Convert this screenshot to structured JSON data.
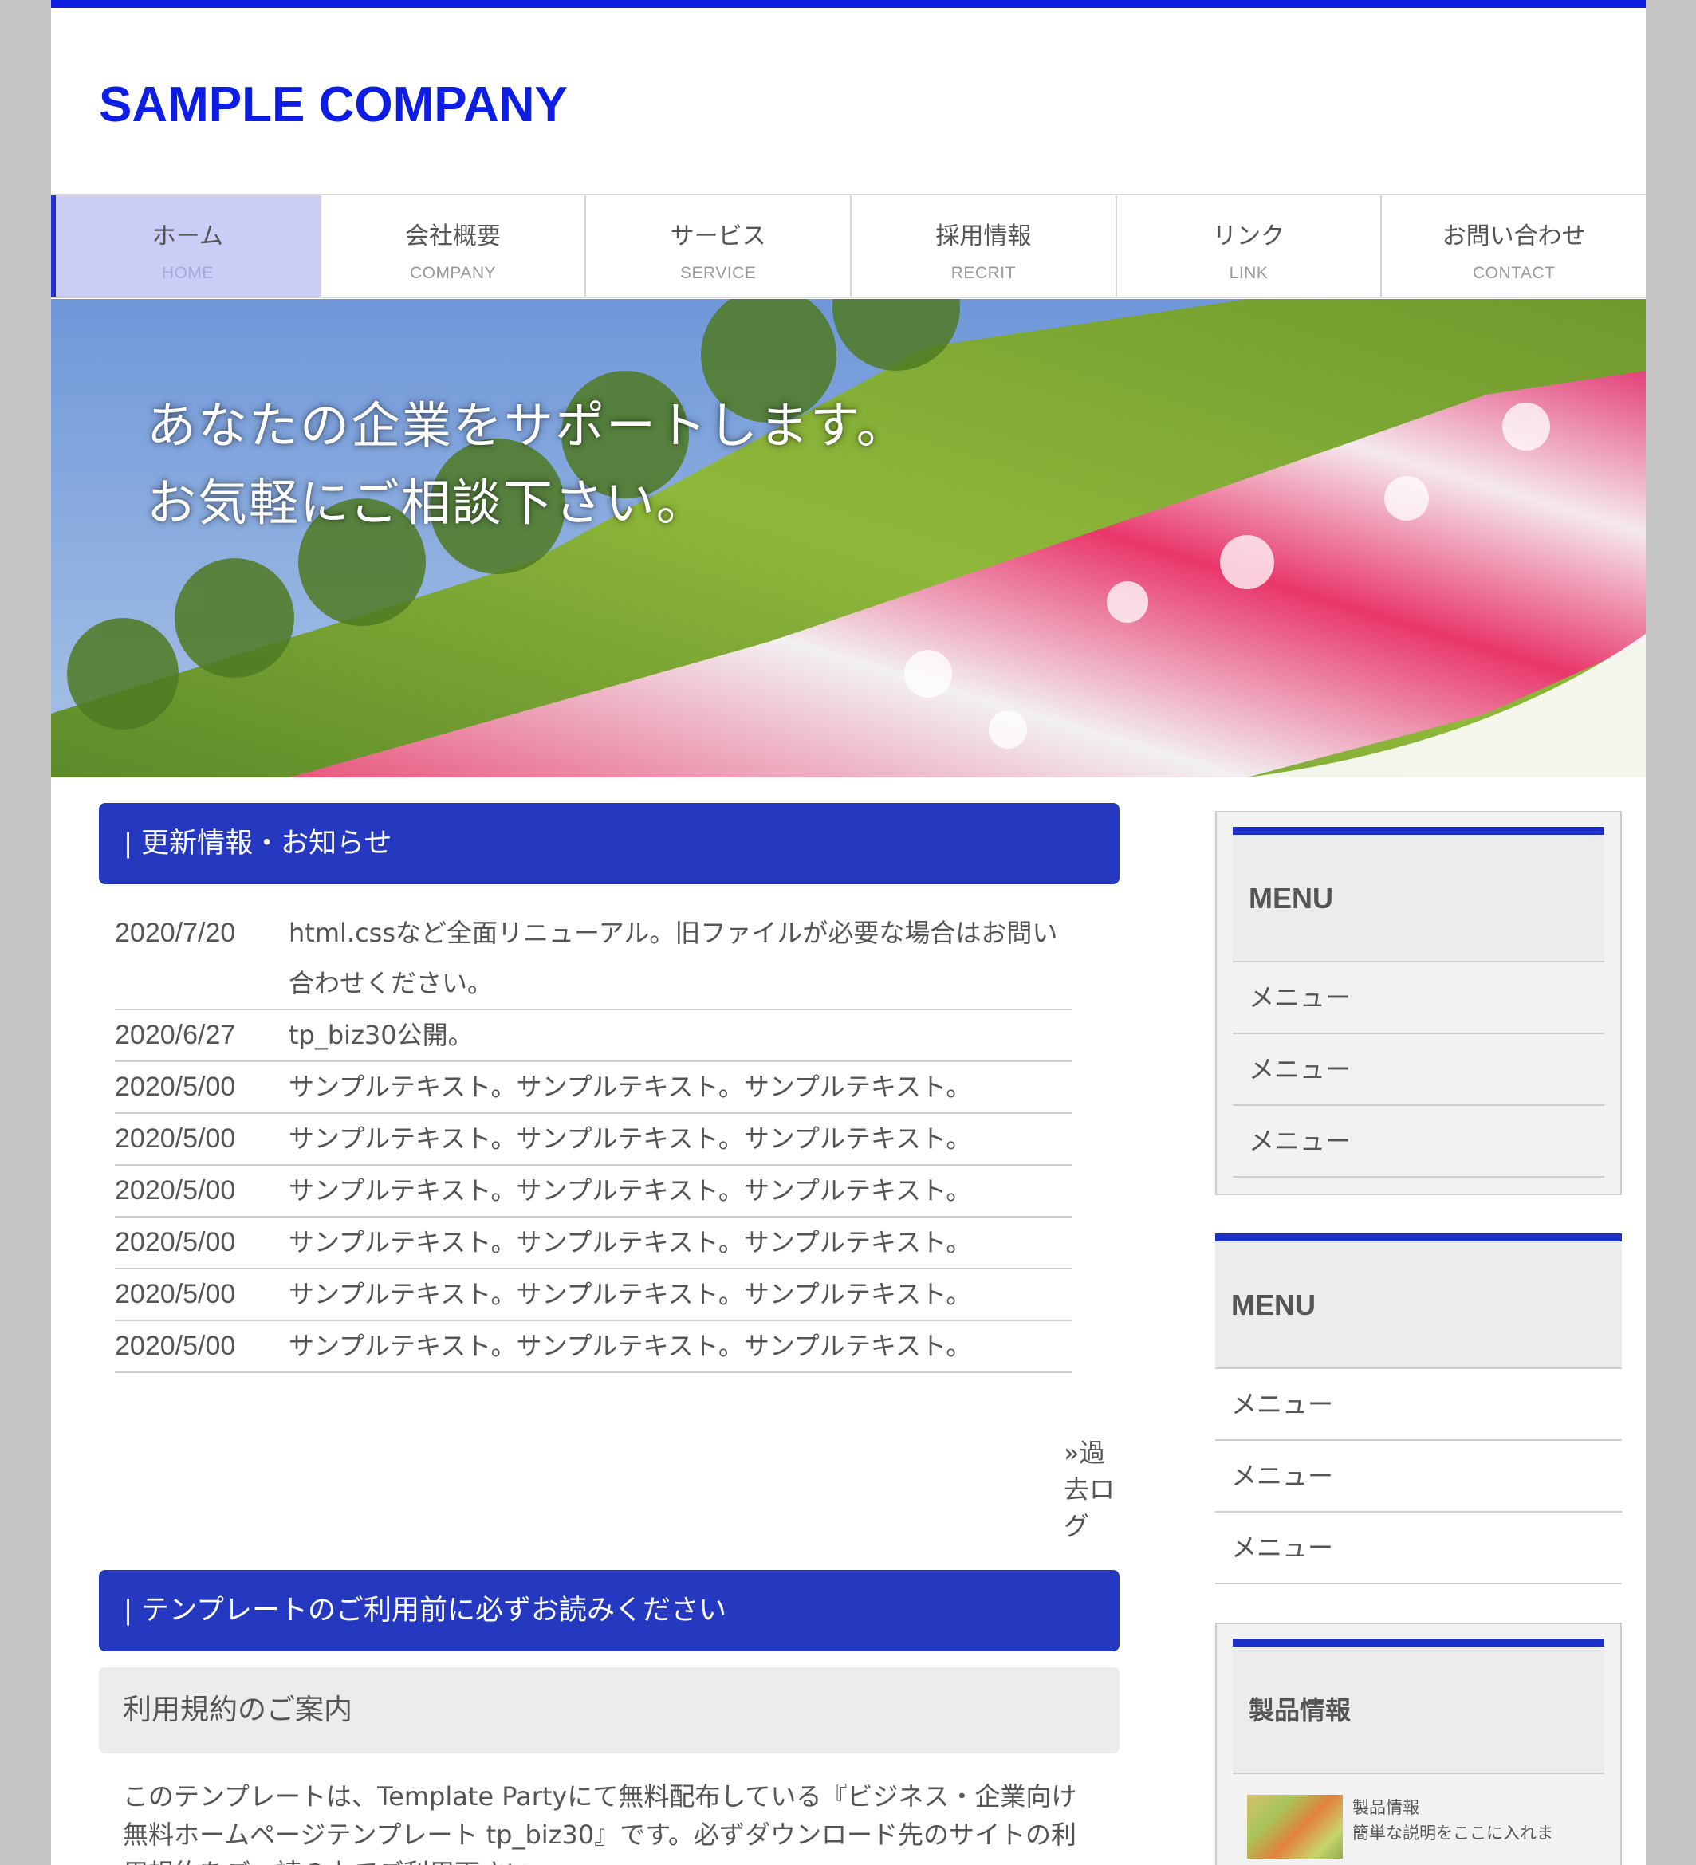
{
  "site": {
    "logo": "SAMPLE COMPANY"
  },
  "nav": [
    {
      "jp": "ホーム",
      "en": "HOME"
    },
    {
      "jp": "会社概要",
      "en": "COMPANY"
    },
    {
      "jp": "サービス",
      "en": "SERVICE"
    },
    {
      "jp": "採用情報",
      "en": "RECRIT"
    },
    {
      "jp": "リンク",
      "en": "LINK"
    },
    {
      "jp": "お問い合わせ",
      "en": "CONTACT"
    }
  ],
  "hero": {
    "line1": "あなたの企業をサポートします。",
    "line2": "お気軽にご相談下さい。"
  },
  "news": {
    "heading": "更新情報・お知らせ",
    "items": [
      {
        "date": "2020/7/20",
        "text": "html.cssなど全面リニューアル。旧ファイルが必要な場合はお問い合わせください。"
      },
      {
        "date": "2020/6/27",
        "text": "tp_biz30公開。"
      },
      {
        "date": "2020/5/00",
        "text": "サンプルテキスト。サンプルテキスト。サンプルテキスト。"
      },
      {
        "date": "2020/5/00",
        "text": "サンプルテキスト。サンプルテキスト。サンプルテキスト。"
      },
      {
        "date": "2020/5/00",
        "text": "サンプルテキスト。サンプルテキスト。サンプルテキスト。"
      },
      {
        "date": "2020/5/00",
        "text": "サンプルテキスト。サンプルテキスト。サンプルテキスト。"
      },
      {
        "date": "2020/5/00",
        "text": "サンプルテキスト。サンプルテキスト。サンプルテキスト。"
      },
      {
        "date": "2020/5/00",
        "text": "サンプルテキスト。サンプルテキスト。サンプルテキスト。"
      }
    ],
    "past_log": "»過去ログ"
  },
  "notice": {
    "heading": "テンプレートのご利用前に必ずお読みください",
    "subheading": "利用規約のご案内",
    "paragraph": "このテンプレートは、Template Partyにて無料配布している『ビジネス・企業向け 無料ホームページテンプレート tp_biz30』です。必ずダウンロード先のサイトの利用規約をご一読の上でご利用下さい。"
  },
  "sidebar": {
    "menu1": {
      "title": "MENU",
      "items": [
        "メニュー",
        "メニュー",
        "メニュー"
      ]
    },
    "menu2": {
      "title": "MENU",
      "items": [
        "メニュー",
        "メニュー",
        "メニュー"
      ]
    },
    "products": {
      "title": "製品情報",
      "item_title": "製品情報",
      "item_desc": "簡単な説明をここに入れま"
    }
  },
  "colors": {
    "brand_blue": "#0d1de3",
    "heading_blue": "#2538c0",
    "nav_active": "#cbcdf7"
  }
}
